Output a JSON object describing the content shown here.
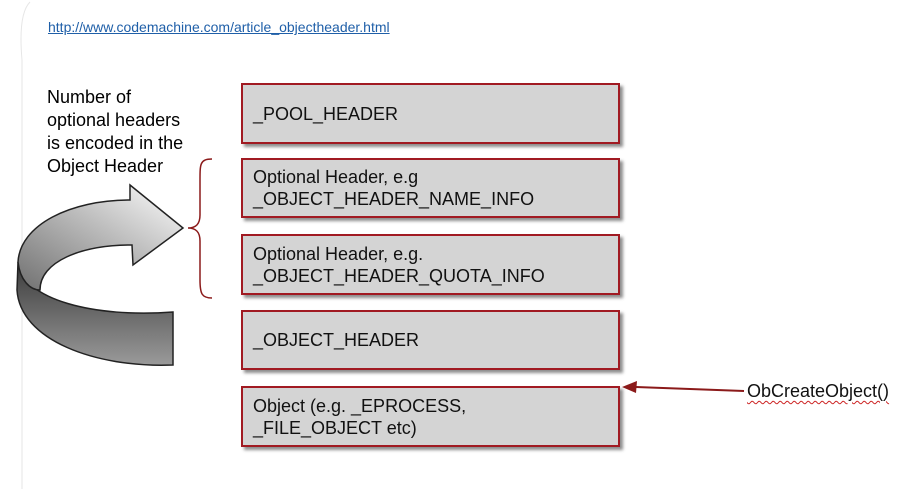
{
  "link": {
    "text": "http://www.codemachine.com/article_objectheader.html"
  },
  "note": {
    "text": "Number of\noptional headers\nis encoded in the\nObject Header"
  },
  "boxes": [
    {
      "label": "_POOL_HEADER"
    },
    {
      "label": "Optional Header, e.g\n_OBJECT_HEADER_NAME_INFO"
    },
    {
      "label": "Optional Header, e.g.\n_OBJECT_HEADER_QUOTA_INFO"
    },
    {
      "label": "_OBJECT_HEADER"
    },
    {
      "label": "Object (e.g. _EPROCESS,\n_FILE_OBJECT etc)"
    }
  ],
  "call": {
    "label": "ObCreateObject()"
  },
  "colors": {
    "box_fill": "#d4d4d4",
    "box_border": "#a11a22",
    "arrow_color": "#8b1a1a",
    "link_color": "#1f5fa8"
  }
}
